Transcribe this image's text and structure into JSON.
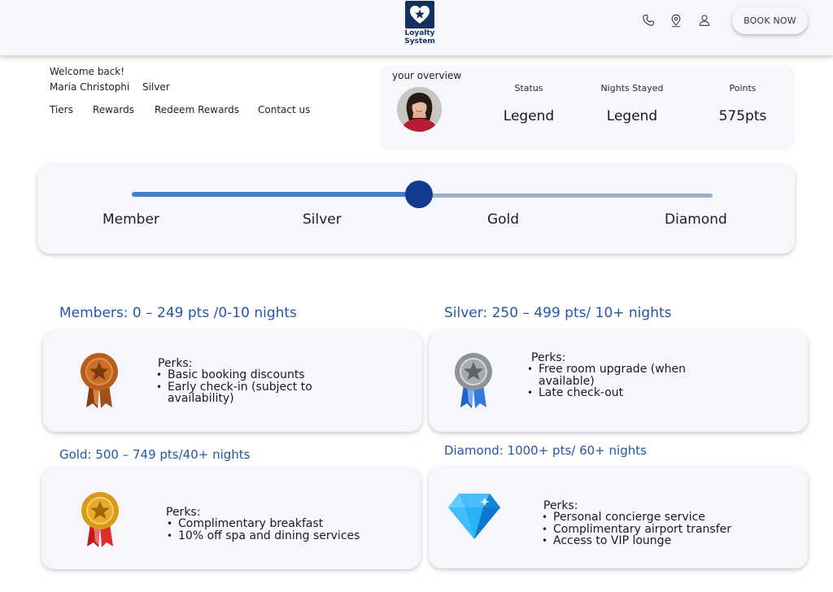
{
  "header": {
    "logo_line1": "Loyalty",
    "logo_line2": "System",
    "book_label": "BOOK NOW",
    "icons": [
      "phone-icon",
      "location-pin-icon",
      "user-icon"
    ]
  },
  "welcome": {
    "greeting": "Welcome back!",
    "name": "Maria Christophi",
    "tier": "Silver"
  },
  "nav": [
    "Tiers",
    "Rewards",
    "Redeem Rewards",
    "Contact us"
  ],
  "overview": {
    "title": "your overview",
    "stats": [
      {
        "label": "Status",
        "value": "Legend"
      },
      {
        "label": "Nights Stayed",
        "value": "Legend"
      },
      {
        "label": "Points",
        "value": "575pts"
      }
    ]
  },
  "progress": {
    "tiers": [
      "Member",
      "Silver",
      "Gold",
      "Diamond"
    ],
    "fraction": 0.5
  },
  "sections": [
    {
      "title": "Members: 0 – 249 pts /0-10 nights",
      "perks_heading": "Perks:",
      "perks": [
        "Basic booking discounts",
        "Early check-in (subject to availability)"
      ],
      "icon": "bronze-medal-icon"
    },
    {
      "title": "Silver: 250 – 499 pts/ 10+ nights",
      "perks_heading": "Perks:",
      "perks": [
        "Free room upgrade (when available)",
        "Late check-out"
      ],
      "icon": "silver-medal-icon"
    },
    {
      "title": "Gold: 500 – 749 pts/40+ nights",
      "perks_heading": "Perks:",
      "perks": [
        "Complimentary breakfast",
        "10% off spa and dining services"
      ],
      "icon": "gold-medal-icon"
    },
    {
      "title": "Diamond: 1000+ pts/ 60+ nights",
      "perks_heading": "Perks:",
      "perks": [
        "Personal concierge service",
        "Complimentary airport transfer",
        "Access to VIP lounge"
      ],
      "icon": "diamond-icon"
    }
  ],
  "colors": {
    "brand": "#14305f",
    "accent": "#2356a8",
    "progress": "#3f7fd0",
    "knob": "#103b8e",
    "card": "#f6f7fc"
  }
}
